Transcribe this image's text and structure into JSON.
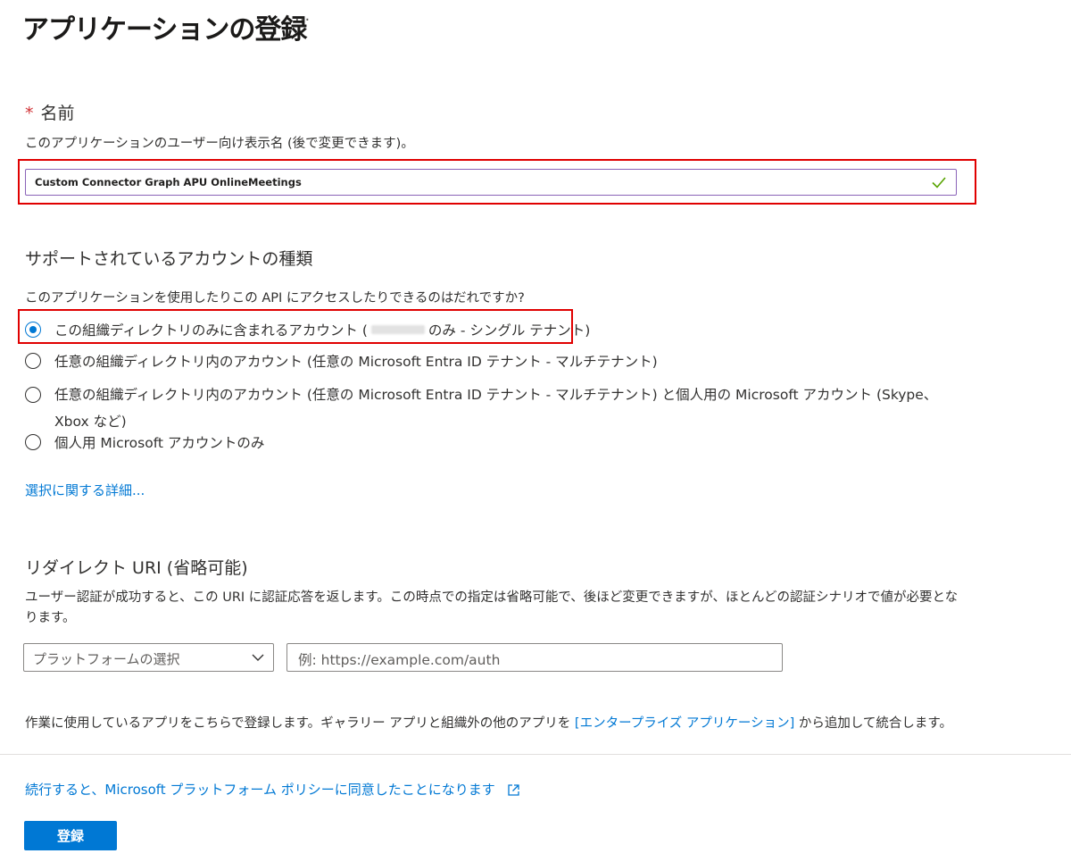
{
  "page": {
    "title": "アプリケーションの登録",
    "more_label": "···"
  },
  "name_section": {
    "required_mark": "*",
    "label": "名前",
    "description": "このアプリケーションのユーザー向け表示名 (後で変更できます)。",
    "input_value": "Custom Connector Graph APU OnlineMeetings",
    "valid_icon": "checkmark-icon"
  },
  "account_section": {
    "heading": "サポートされているアカウントの種類",
    "question": "このアプリケーションを使用したりこの API にアクセスしたりできるのはだれですか?",
    "options": [
      {
        "label_prefix": "この組織ディレクトリのみに含まれるアカウント (",
        "label_suffix": "のみ - シングル テナント)",
        "selected": true
      },
      {
        "label": "任意の組織ディレクトリ内のアカウント (任意の Microsoft Entra ID テナント - マルチテナント)",
        "selected": false
      },
      {
        "label": "任意の組織ディレクトリ内のアカウント (任意の Microsoft Entra ID テナント - マルチテナント) と個人用の Microsoft アカウント (Skype、Xbox など)",
        "selected": false
      },
      {
        "label": "個人用 Microsoft アカウントのみ",
        "selected": false
      }
    ],
    "details_link": "選択に関する詳細..."
  },
  "redirect_section": {
    "heading": "リダイレクト URI (省略可能)",
    "description": "ユーザー認証が成功すると、この URI に認証応答を返します。この時点での指定は省略可能で、後ほど変更できますが、ほとんどの認証シナリオで値が必要となります。",
    "platform_placeholder": "プラットフォームの選択",
    "uri_placeholder": "例: https://example.com/auth"
  },
  "footer_note": {
    "prefix": "作業に使用しているアプリをこちらで登録します。ギャラリー アプリと組織外の他のアプリを ",
    "link": "[エンタープライズ アプリケーション]",
    "suffix": " から追加して統合します。"
  },
  "policy": {
    "link": "続行すると、Microsoft プラットフォーム ポリシーに同意したことになります"
  },
  "register_button": "登録",
  "colors": {
    "accent": "#0078d4",
    "highlight_border": "#e00000",
    "required": "#d13438",
    "valid": "#57a300"
  }
}
